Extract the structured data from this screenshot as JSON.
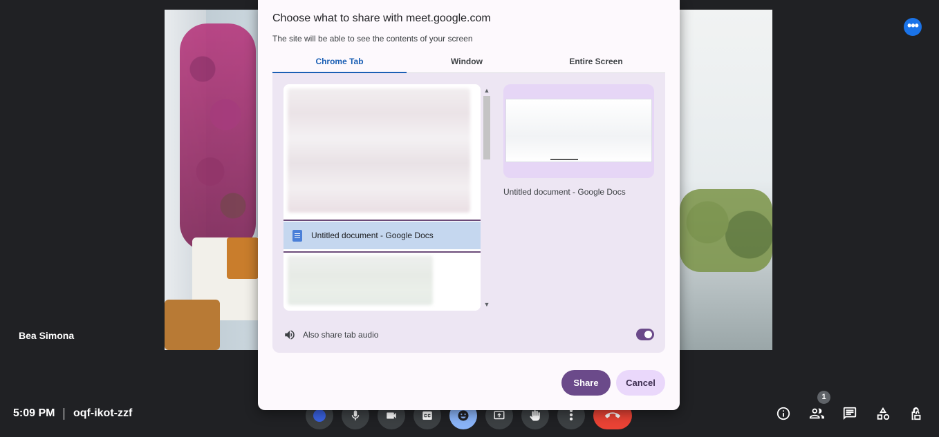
{
  "participant": {
    "name": "Bea Simona"
  },
  "meeting": {
    "time": "5:09 PM",
    "code": "oqf-ikot-zzf"
  },
  "people_count": "1",
  "dialog": {
    "title": "Choose what to share with meet.google.com",
    "subtitle": "The site will be able to see the contents of your screen",
    "tabs": [
      {
        "label": "Chrome Tab",
        "active": true
      },
      {
        "label": "Window",
        "active": false
      },
      {
        "label": "Entire Screen",
        "active": false
      }
    ],
    "selected_tab_item": "Untitled document - Google Docs",
    "preview_title": "Untitled document - Google Docs",
    "audio_label": "Also share tab audio",
    "audio_enabled": true,
    "share_label": "Share",
    "cancel_label": "Cancel"
  },
  "controls": {
    "icons": [
      "circle-icon",
      "microphone-icon",
      "camera-icon",
      "captions-icon",
      "emoji-icon",
      "present-icon",
      "hand-icon",
      "more-vert-icon",
      "end-call-icon"
    ],
    "right_icons": [
      "info-icon",
      "people-icon",
      "chat-icon",
      "activities-icon",
      "host-controls-icon"
    ]
  },
  "colors": {
    "accent": "#6b4a8a",
    "tab_active": "#1a5fb4",
    "end_call": "#ea4335",
    "selected_item": "#c5d7ef"
  }
}
